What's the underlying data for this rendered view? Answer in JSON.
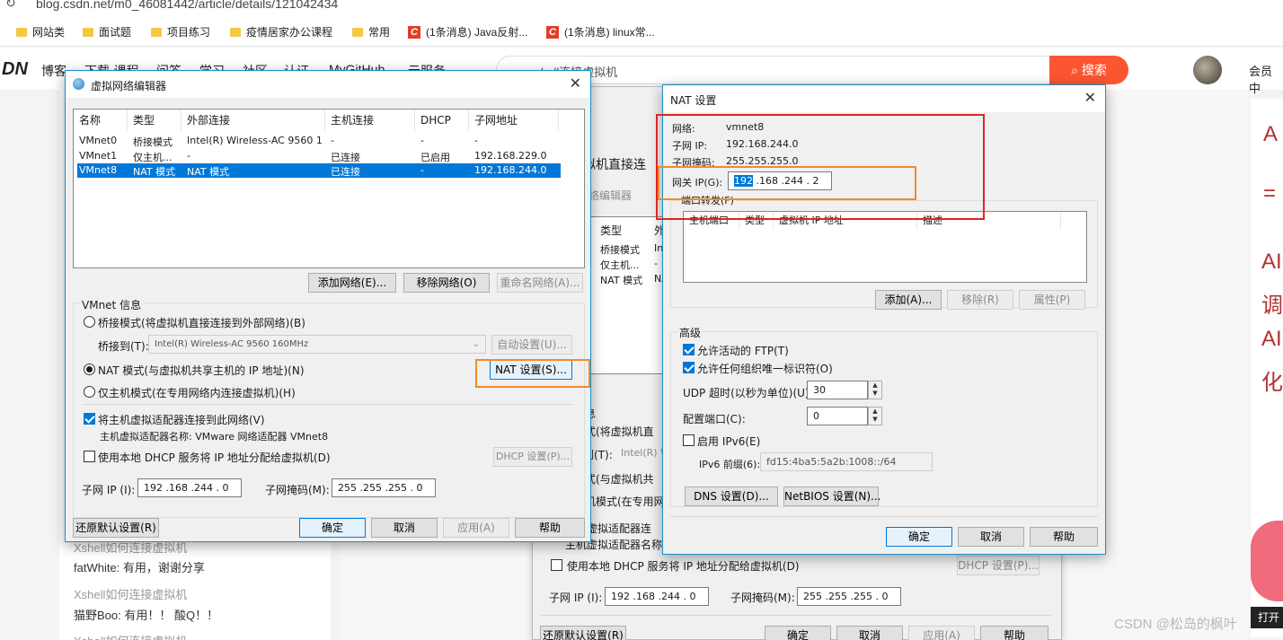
{
  "browser": {
    "url": "blog.csdn.net/m0_46081442/article/details/121042434",
    "bookmarks": [
      {
        "label": "网站类",
        "kind": "folder"
      },
      {
        "label": "面试题",
        "kind": "folder"
      },
      {
        "label": "项目练习",
        "kind": "folder"
      },
      {
        "label": "疫情居家办公课程",
        "kind": "folder"
      },
      {
        "label": "常用",
        "kind": "folder"
      },
      {
        "label": "(1条消息) Java反射...",
        "kind": "csdn"
      },
      {
        "label": "(1条消息) linux常...",
        "kind": "csdn"
      }
    ]
  },
  "csdn": {
    "logo": "DN",
    "nav": [
      "博客",
      "下载·课程",
      "问答",
      "学习",
      "社区",
      "认证",
      "MyGitHub",
      "云服务"
    ],
    "search_text": "xshell连接虚拟机",
    "search_button": "搜索",
    "member": "会员中",
    "right_chars": [
      "A",
      "=",
      "AI",
      "调",
      "AI",
      "化"
    ],
    "comments": [
      {
        "title": "Xshell如何连接虚拟机",
        "text": "fatWhite: 有用，谢谢分享"
      },
      {
        "title": "Xshell如何连接虚拟机",
        "text": "猫野Boo: 有用！！ 酸Q！！"
      },
      {
        "title": "Xshell如何连接虚拟机",
        "text": ""
      }
    ],
    "watermark": "CSDN @松岛的枫叶",
    "right_bottom": "打开"
  },
  "vne": {
    "title": "虚拟网络编辑器",
    "columns": [
      "名称",
      "类型",
      "外部连接",
      "主机连接",
      "DHCP",
      "子网地址"
    ],
    "rows": [
      [
        "VMnet0",
        "桥接模式",
        "Intel(R) Wireless-AC 9560 1...",
        "-",
        "-",
        "-"
      ],
      [
        "VMnet1",
        "仅主机...",
        "-",
        "已连接",
        "已启用",
        "192.168.229.0"
      ],
      [
        "VMnet8",
        "NAT 模式",
        "NAT 模式",
        "已连接",
        "-",
        "192.168.244.0"
      ]
    ],
    "selected_row": 2,
    "add_network": "添加网络(E)...",
    "remove_network": "移除网络(O)",
    "rename_network": "重命名网络(A)...",
    "vmnet_info": "VMnet 信息",
    "bridged_mode": "桥接模式(将虚拟机直接连接到外部网络)(B)",
    "bridged_to": "桥接到(T):",
    "bridged_adapter": "Intel(R) Wireless-AC 9560 160MHz",
    "auto_settings": "自动设置(U)...",
    "nat_mode": "NAT 模式(与虚拟机共享主机的 IP 地址)(N)",
    "nat_settings": "NAT 设置(S)...",
    "host_only_mode": "仅主机模式(在专用网络内连接虚拟机)(H)",
    "connect_host_adapter": "将主机虚拟适配器连接到此网络(V)",
    "host_adapter_name": "主机虚拟适配器名称: VMware 网络适配器 VMnet8",
    "use_dhcp": "使用本地 DHCP 服务将 IP 地址分配给虚拟机(D)",
    "dhcp_settings": "DHCP 设置(P)...",
    "subnet_ip_label": "子网 IP (I):",
    "subnet_ip": "192 .168 .244 . 0",
    "subnet_mask_label": "子网掩码(M):",
    "subnet_mask": "255 .255 .255 . 0",
    "restore_defaults": "还原默认设置(R)",
    "ok": "确定",
    "cancel": "取消",
    "apply": "应用(A)",
    "help": "帮助"
  },
  "bg_vne": {
    "title_fragment": "拟机直接连",
    "tab_fragment": "络编辑器",
    "col_type": "类型",
    "col_ext": "外",
    "types": [
      "桥接模式",
      "仅主机...",
      "NAT 模式"
    ],
    "ext": [
      "In",
      "-",
      "NA"
    ],
    "info_fragment": "息",
    "bridged_fragment": "式(将虚拟机直",
    "bridged_to_fragment": "到(T):",
    "bridged_adapter_fragment": "Intel(R) W",
    "nat_fragment": "式(与虚拟机共",
    "host_only_fragment": "机模式(在专用网",
    "connect_fragment": "主机虚拟适配器连",
    "adapter_fragment": "主机虚拟适配器名称",
    "use_dhcp": "使用本地 DHCP 服务将 IP 地址分配给虚拟机(D)",
    "dhcp_settings": "DHCP 设置(P)...",
    "subnet_ip_label": "子网 IP (I):",
    "subnet_ip": "192 .168 .244 . 0",
    "subnet_mask_label": "子网掩码(M):",
    "subnet_mask": "255 .255 .255 . 0",
    "restore_defaults": "还原默认设置(R)",
    "ok": "确定",
    "cancel": "取消",
    "apply": "应用(A)",
    "help": "帮助"
  },
  "nat": {
    "title": "NAT 设置",
    "network_label": "网络:",
    "network": "vmnet8",
    "subnet_ip_label": "子网 IP:",
    "subnet_ip": "192.168.244.0",
    "subnet_mask_label": "子网掩码:",
    "subnet_mask": "255.255.255.0",
    "gateway_label": "网关 IP(G):",
    "gateway_selected": "192",
    "gateway_rest": " .168 .244 . 2",
    "port_forwarding": "端口转发(F)",
    "pf_columns": [
      "主机端口",
      "类型",
      "虚拟机 IP 地址",
      "描述"
    ],
    "add": "添加(A)...",
    "remove": "移除(R)",
    "properties": "属性(P)",
    "advanced": "高级",
    "allow_ftp": "允许活动的 FTP(T)",
    "allow_oui": "允许任何组织唯一标识符(O)",
    "udp_timeout_label": "UDP 超时(以秒为单位)(U):",
    "udp_timeout": "30",
    "config_port_label": "配置端口(C):",
    "config_port": "0",
    "enable_ipv6": "启用 IPv6(E)",
    "ipv6_prefix_label": "IPv6 前缀(6):",
    "ipv6_prefix": "fd15:4ba5:5a2b:1008::/64",
    "dns_settings": "DNS 设置(D)...",
    "netbios_settings": "NetBIOS 设置(N)...",
    "ok": "确定",
    "cancel": "取消",
    "help": "帮助"
  }
}
